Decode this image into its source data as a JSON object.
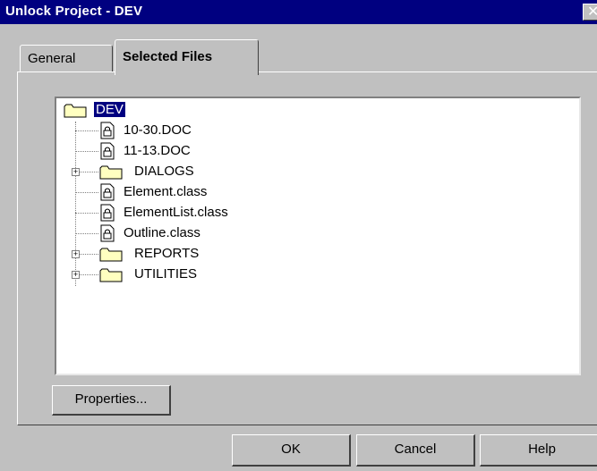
{
  "window": {
    "title": "Unlock Project - DEV",
    "close_glyph": "✕"
  },
  "tabs": [
    {
      "label": "General",
      "selected": false
    },
    {
      "label": "Selected Files",
      "selected": true
    }
  ],
  "tree": {
    "root": {
      "label": "DEV",
      "icon": "folder-icon",
      "selected": true
    },
    "children": [
      {
        "label": "10-30.DOC",
        "icon": "locked-file-icon",
        "expandable": false
      },
      {
        "label": "11-13.DOC",
        "icon": "locked-file-icon",
        "expandable": false
      },
      {
        "label": "DIALOGS",
        "icon": "folder-icon",
        "expandable": true,
        "expander_glyph": "+"
      },
      {
        "label": "Element.class",
        "icon": "locked-file-icon",
        "expandable": false
      },
      {
        "label": "ElementList.class",
        "icon": "locked-file-icon",
        "expandable": false
      },
      {
        "label": "Outline.class",
        "icon": "locked-file-icon",
        "expandable": false
      },
      {
        "label": "REPORTS",
        "icon": "folder-icon",
        "expandable": true,
        "expander_glyph": "+"
      },
      {
        "label": "UTILITIES",
        "icon": "folder-icon",
        "expandable": true,
        "expander_glyph": "+"
      }
    ]
  },
  "buttons": {
    "properties": "Properties...",
    "ok": "OK",
    "cancel": "Cancel",
    "help": "Help"
  },
  "colors": {
    "titlebar": "#000080",
    "dialog_face": "#c0c0c0",
    "selection": "#000080",
    "folder": "#ffffc0"
  }
}
